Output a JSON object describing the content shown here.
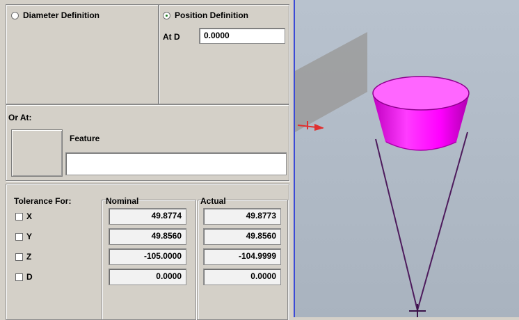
{
  "definition": {
    "diameter_label": "Diameter Definition",
    "position_label": "Position Definition",
    "at_d_label": "At D",
    "at_d_value": "0.0000"
  },
  "or_at": {
    "label": "Or At:",
    "feature_label": "Feature",
    "feature_value": ""
  },
  "tolerance": {
    "label": "Tolerance For:",
    "nominal_header": "Nominal",
    "actual_header": "Actual",
    "rows": [
      {
        "axis": "X",
        "nominal": "49.8774",
        "actual": "49.8773"
      },
      {
        "axis": "Y",
        "nominal": "49.8560",
        "actual": "49.8560"
      },
      {
        "axis": "Z",
        "nominal": "-105.0000",
        "actual": "-104.9999"
      },
      {
        "axis": "D",
        "nominal": "0.0000",
        "actual": "0.0000"
      }
    ]
  },
  "viewport": {
    "cone_color": "#ff00ff",
    "plane_color": "#9b9b9b",
    "line_color": "#4d1b5c",
    "marker_color": "#e03030"
  }
}
